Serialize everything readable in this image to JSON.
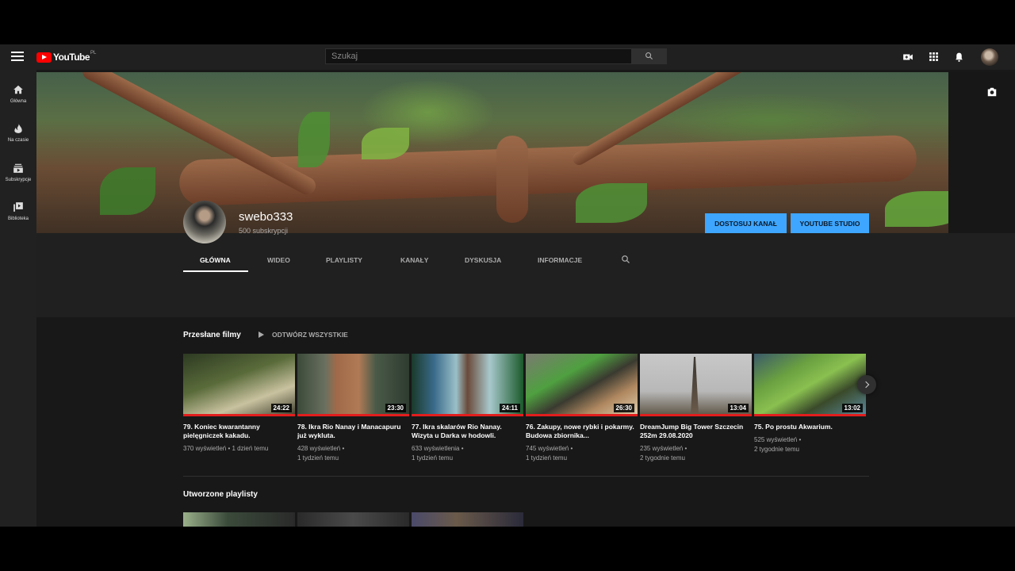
{
  "masthead": {
    "logo_text": "YouTube",
    "logo_country": "PL",
    "search_placeholder": "Szukaj"
  },
  "sidebar": {
    "items": [
      {
        "label": "Główna",
        "icon": "home-icon"
      },
      {
        "label": "Na czasie",
        "icon": "flame-icon"
      },
      {
        "label": "Subskrypcje",
        "icon": "subscriptions-icon"
      },
      {
        "label": "Biblioteka",
        "icon": "library-icon"
      }
    ]
  },
  "channel": {
    "name": "swebo333",
    "subscribers": "500 subskrypcji",
    "customize_button": "DOSTOSUJ KANAŁ",
    "studio_button": "YOUTUBE STUDIO"
  },
  "tabs": [
    {
      "label": "GŁÓWNA",
      "active": true
    },
    {
      "label": "WIDEO",
      "active": false
    },
    {
      "label": "PLAYLISTY",
      "active": false
    },
    {
      "label": "KANAŁY",
      "active": false
    },
    {
      "label": "DYSKUSJA",
      "active": false
    },
    {
      "label": "INFORMACJE",
      "active": false
    }
  ],
  "uploads": {
    "title": "Przesłane filmy",
    "play_all": "ODTWÓRZ WSZYSTKIE",
    "videos": [
      {
        "title": "79. Koniec kwarantanny pielęgniczek kakadu.",
        "duration": "24:22",
        "meta_line1": "370 wyświetleń • 1 dzień temu",
        "meta_line2": ""
      },
      {
        "title": "78. Ikra Rio Nanay i Manacapuru już wykluta.",
        "duration": "23:30",
        "meta_line1": "428 wyświetleń •",
        "meta_line2": "1 tydzień temu"
      },
      {
        "title": "77. Ikra skalarów Rio Nanay. Wizyta u Darka w hodowli.",
        "duration": "24:11",
        "meta_line1": "633 wyświetlenia •",
        "meta_line2": "1 tydzień temu"
      },
      {
        "title": "76. Zakupy, nowe rybki i pokarmy. Budowa zbiornika...",
        "duration": "26:30",
        "meta_line1": "745 wyświetleń •",
        "meta_line2": "1 tydzień temu"
      },
      {
        "title": "DreamJump Big Tower Szczecin 252m 29.08.2020",
        "duration": "13:04",
        "meta_line1": "235 wyświetleń •",
        "meta_line2": "2 tygodnie temu"
      },
      {
        "title": "75. Po prostu Akwarium.",
        "duration": "13:02",
        "meta_line1": "525 wyświetleń •",
        "meta_line2": "2 tygodnie temu"
      }
    ]
  },
  "playlists": {
    "title": "Utworzone playlisty"
  },
  "colors": {
    "accent_blue": "#3ea6ff",
    "progress_red": "#e21d1d",
    "logo_red": "#ff0000"
  }
}
